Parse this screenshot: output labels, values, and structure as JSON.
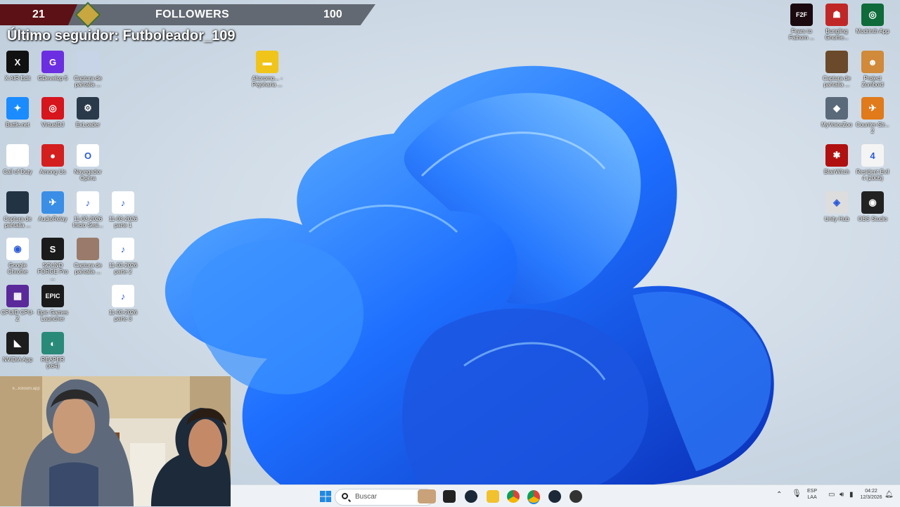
{
  "overlay": {
    "follower_count": "21",
    "title": "FOLLOWERS",
    "goal": "100",
    "last_follower": "Último seguidor: Futboleador_109"
  },
  "icons_left": [
    {
      "label": "X AIR Edit",
      "color": "#111111",
      "glyph": "X"
    },
    {
      "label": "GDevelop 5",
      "color": "#6b2ee0",
      "glyph": "G"
    },
    {
      "label": "Captura de pantalla ...",
      "color": "#c7d4e8",
      "glyph": ""
    },
    {
      "label": "Battle.net",
      "color": "#1a8cff",
      "glyph": "✦"
    },
    {
      "label": "VirtualDJ",
      "color": "#d6151c",
      "glyph": "◎"
    },
    {
      "label": "ExLoader",
      "color": "#2a3a4a",
      "glyph": "⚙"
    },
    {
      "label": "Call of Duty",
      "color": "#ffffff",
      "glyph": ""
    },
    {
      "label": "Among Us",
      "color": "#d41f1f",
      "glyph": "●"
    },
    {
      "label": "Navegador Opera",
      "color": "#ffffff",
      "glyph": "O"
    },
    {
      "label": "Captura de pantalla ...",
      "color": "#223344",
      "glyph": ""
    },
    {
      "label": "AudioRelay",
      "color": "#3a8ee6",
      "glyph": "✈"
    },
    {
      "label": "11-03-2026 Inicio Sesi...",
      "color": "#ffffff",
      "glyph": "♪"
    },
    {
      "label": "11-03-2026 parte 1",
      "color": "#ffffff",
      "glyph": "♪"
    },
    {
      "label": "Google Chrome",
      "color": "#ffffff",
      "glyph": "◉"
    },
    {
      "label": "SOUND FORGE Pro ...",
      "color": "#1b1b1b",
      "glyph": "S"
    },
    {
      "label": "Captura de pantalla ...",
      "color": "#9a7a6a",
      "glyph": ""
    },
    {
      "label": "11-03-2026 parte 2",
      "color": "#ffffff",
      "glyph": "♪"
    },
    {
      "label": "CPUID CPU-Z",
      "color": "#5a2a9a",
      "glyph": "▦"
    },
    {
      "label": "Epic Games Launcher",
      "color": "#1a1a1a",
      "glyph": "EPIC"
    },
    {
      "label": "11-03-2026 parte 3",
      "color": "#ffffff",
      "glyph": "♪"
    },
    {
      "label": "NVIDIA App",
      "color": "#1d1d1d",
      "glyph": "◣"
    },
    {
      "label": "REAPER (x64)",
      "color": "#2a8a7a",
      "glyph": "◐"
    }
  ],
  "icons_top": [
    {
      "label": "Altoromo... - Pejoharia ...",
      "color": "#f0c419",
      "glyph": "▬"
    }
  ],
  "icons_right": [
    {
      "label": "Fears to Fathom ...",
      "color": "#1a0a10",
      "glyph": "F2F"
    },
    {
      "label": "Bungling Gnome...",
      "color": "#c02828",
      "glyph": "☗"
    },
    {
      "label": "Modrinth App",
      "color": "#0f6b3a",
      "glyph": "◎"
    },
    {
      "label": "Captura de pantalla ...",
      "color": "#6a4a2a",
      "glyph": ""
    },
    {
      "label": "Project Zomboid",
      "color": "#d08a3a",
      "glyph": "☻"
    },
    {
      "label": "MyVoiceZoo",
      "color": "#5a6a7a",
      "glyph": "◆"
    },
    {
      "label": "Counter-Str... 2",
      "color": "#e07a1a",
      "glyph": "✈"
    },
    {
      "label": "BlairWitch",
      "color": "#b01010",
      "glyph": "✱"
    },
    {
      "label": "Resident Evil 4 (2005)",
      "color": "#f4f4f4",
      "glyph": "4"
    },
    {
      "label": "Unity Hub",
      "color": "#dddddd",
      "glyph": "◈"
    },
    {
      "label": "OBS Studio",
      "color": "#222222",
      "glyph": "◉"
    }
  ],
  "webcam": {
    "tag": "k...ksloom.app"
  },
  "taskbar": {
    "search_placeholder": "Buscar",
    "lang_top": "ESP",
    "lang_bottom": "LAA",
    "time": "04:22",
    "date": "12/3/2026"
  }
}
